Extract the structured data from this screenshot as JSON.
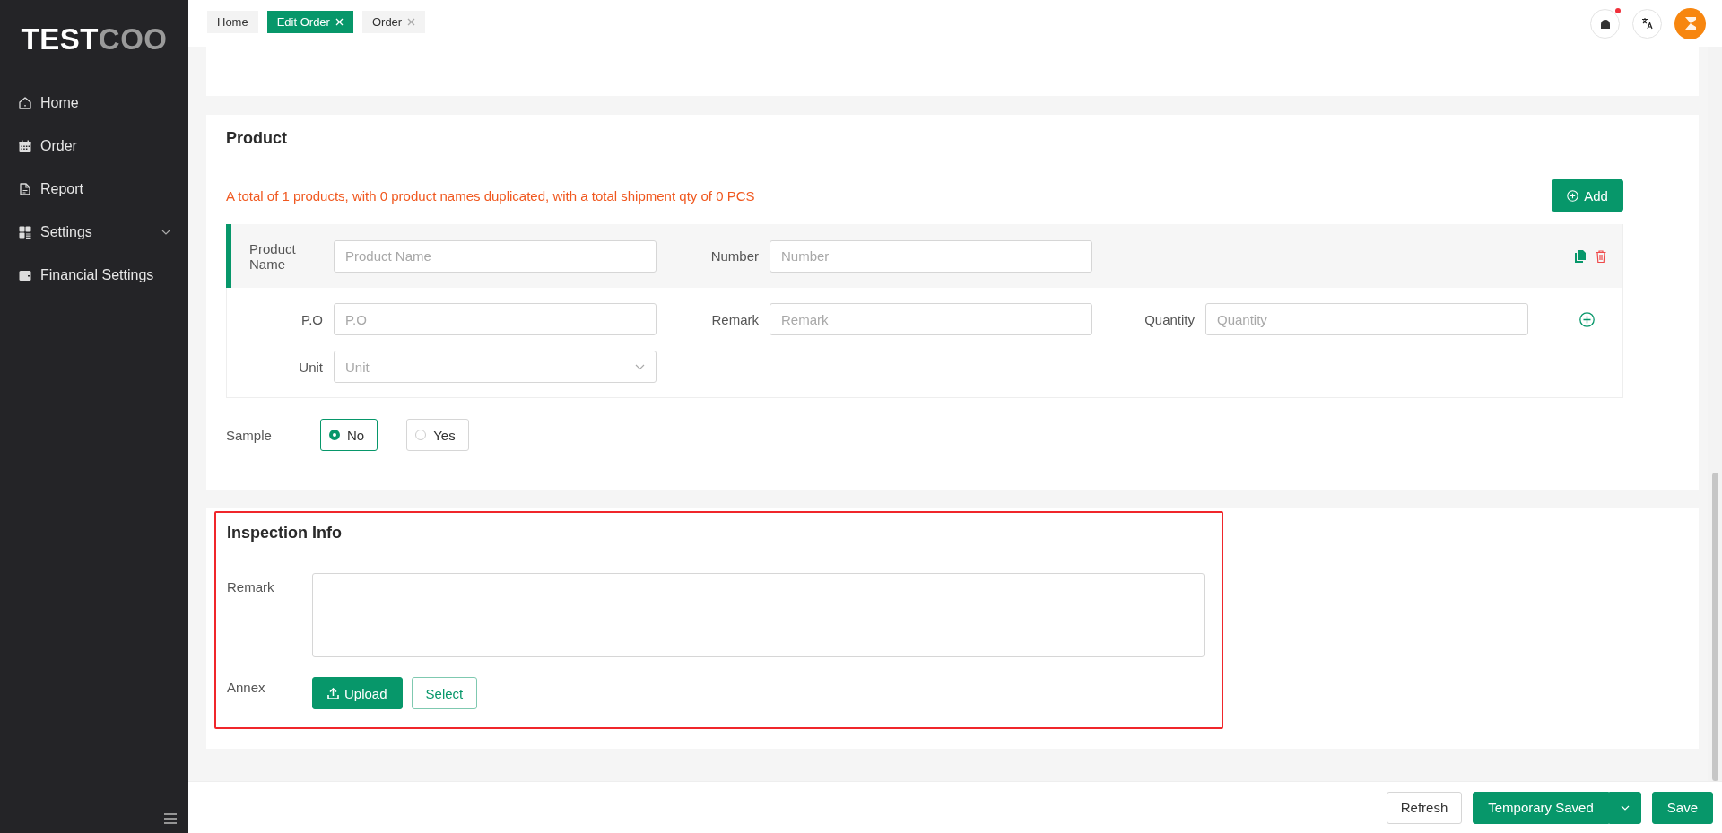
{
  "logo": {
    "primary": "TEST",
    "secondary": "COO"
  },
  "sidebar": {
    "items": [
      {
        "label": "Home",
        "expandable": false
      },
      {
        "label": "Order",
        "expandable": false
      },
      {
        "label": "Report",
        "expandable": false
      },
      {
        "label": "Settings",
        "expandable": true
      },
      {
        "label": "Financial Settings",
        "expandable": false
      }
    ]
  },
  "tabs": [
    {
      "label": "Home",
      "selected": false,
      "closable": false
    },
    {
      "label": "Edit Order",
      "selected": true,
      "closable": true
    },
    {
      "label": "Order",
      "selected": false,
      "closable": true
    }
  ],
  "header": {
    "notification_unread": true
  },
  "product": {
    "title": "Product",
    "summary": "A total of 1 products, with 0 product names duplicated, with a total shipment qty of 0 PCS",
    "add_button": "Add",
    "header_fields": [
      {
        "label": "Product Name",
        "placeholder": "Product Name",
        "kind": "text"
      },
      {
        "label": "Number",
        "placeholder": "Number",
        "kind": "text"
      }
    ],
    "detail_fields": [
      {
        "label": "P.O",
        "placeholder": "P.O",
        "kind": "text"
      },
      {
        "label": "Remark",
        "placeholder": "Remark",
        "kind": "text"
      },
      {
        "label": "Quantity",
        "placeholder": "Quantity",
        "kind": "text"
      },
      {
        "label": "Unit",
        "placeholder": "Unit",
        "kind": "select"
      }
    ],
    "sample": {
      "label": "Sample",
      "options": [
        {
          "label": "No",
          "selected": true
        },
        {
          "label": "Yes",
          "selected": false
        }
      ]
    }
  },
  "inspection": {
    "title": "Inspection Info",
    "highlighted": true,
    "remark_label": "Remark",
    "annex_label": "Annex",
    "upload_button": "Upload",
    "select_button": "Select"
  },
  "footer": {
    "buttons": [
      {
        "label": "Refresh",
        "kind": "default"
      },
      {
        "label": "Temporary Saved",
        "kind": "split"
      },
      {
        "label": "Save",
        "kind": "primary"
      }
    ]
  }
}
